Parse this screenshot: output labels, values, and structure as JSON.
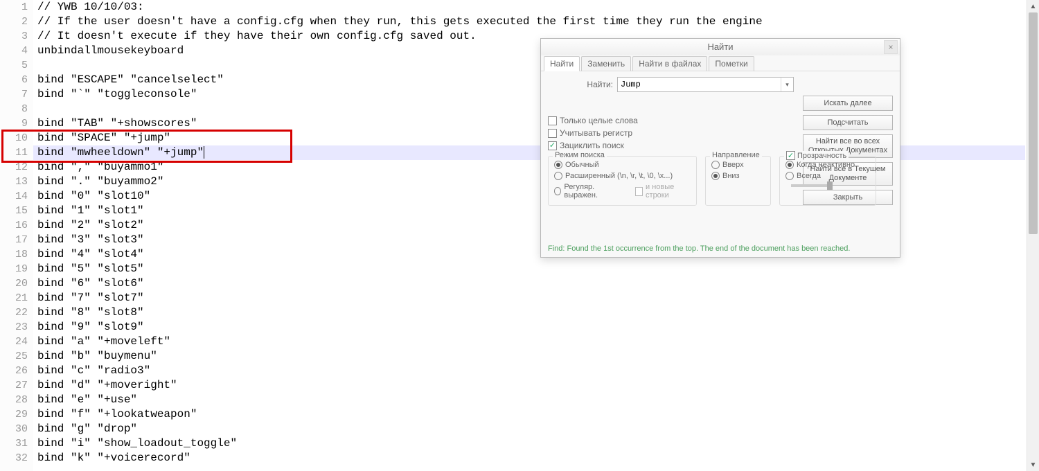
{
  "editor": {
    "lines": [
      "// YWB 10/10/03:",
      "// If the user doesn't have a config.cfg when they run, this gets executed the first time they run the engine",
      "// It doesn't execute if they have their own config.cfg saved out.",
      "unbindallmousekeyboard",
      "",
      "bind \"ESCAPE\" \"cancelselect\"",
      "bind \"`\" \"toggleconsole\"",
      "",
      "bind \"TAB\" \"+showscores\"",
      "bind \"SPACE\" \"+jump\"",
      "bind \"mwheeldown\" \"+jump\"",
      "bind \",\" \"buyammo1\"",
      "bind \".\" \"buyammo2\"",
      "bind \"0\" \"slot10\"",
      "bind \"1\" \"slot1\"",
      "bind \"2\" \"slot2\"",
      "bind \"3\" \"slot3\"",
      "bind \"4\" \"slot4\"",
      "bind \"5\" \"slot5\"",
      "bind \"6\" \"slot6\"",
      "bind \"7\" \"slot7\"",
      "bind \"8\" \"slot8\"",
      "bind \"9\" \"slot9\"",
      "bind \"a\" \"+moveleft\"",
      "bind \"b\" \"buymenu\"",
      "bind \"c\" \"radio3\"",
      "bind \"d\" \"+moveright\"",
      "bind \"e\" \"+use\"",
      "bind \"f\" \"+lookatweapon\"",
      "bind \"g\" \"drop\"",
      "bind \"i\" \"show_loadout_toggle\"",
      "bind \"k\" \"+voicerecord\""
    ],
    "highlighted_rows": [
      10,
      11
    ],
    "box_rows": [
      10,
      11
    ]
  },
  "find_dialog": {
    "title": "Найти",
    "close_glyph": "×",
    "tabs": {
      "find": "Найти",
      "replace": "Заменить",
      "find_in_files": "Найти в файлах",
      "marks": "Пометки"
    },
    "search": {
      "label": "Найти:",
      "value": "Jump"
    },
    "buttons": {
      "find_next": "Искать далее",
      "count": "Подсчитать",
      "find_all_open": "Найти все во всех Открытых Документах",
      "find_all_current": "Найти все в Текущем Документе",
      "close": "Закрыть"
    },
    "checks": {
      "whole_words": "Только целые слова",
      "match_case": "Учитывать регистр",
      "wrap_around": "Зациклить поиск"
    },
    "groups": {
      "mode": {
        "title": "Режим поиска",
        "normal": "Обычный",
        "extended": "Расширенный (\\n, \\r, \\t, \\0, \\x...)",
        "regex": "Регуляр. выражен.",
        "newlines": "и новые строки"
      },
      "direction": {
        "title": "Направление",
        "up": "Вверх",
        "down": "Вниз"
      },
      "transparency": {
        "title": "Прозрачность",
        "when_inactive": "Когда неактивно",
        "always": "Всегда"
      }
    },
    "status": "Find: Found the 1st occurrence from the top. The end of the document has been reached."
  }
}
